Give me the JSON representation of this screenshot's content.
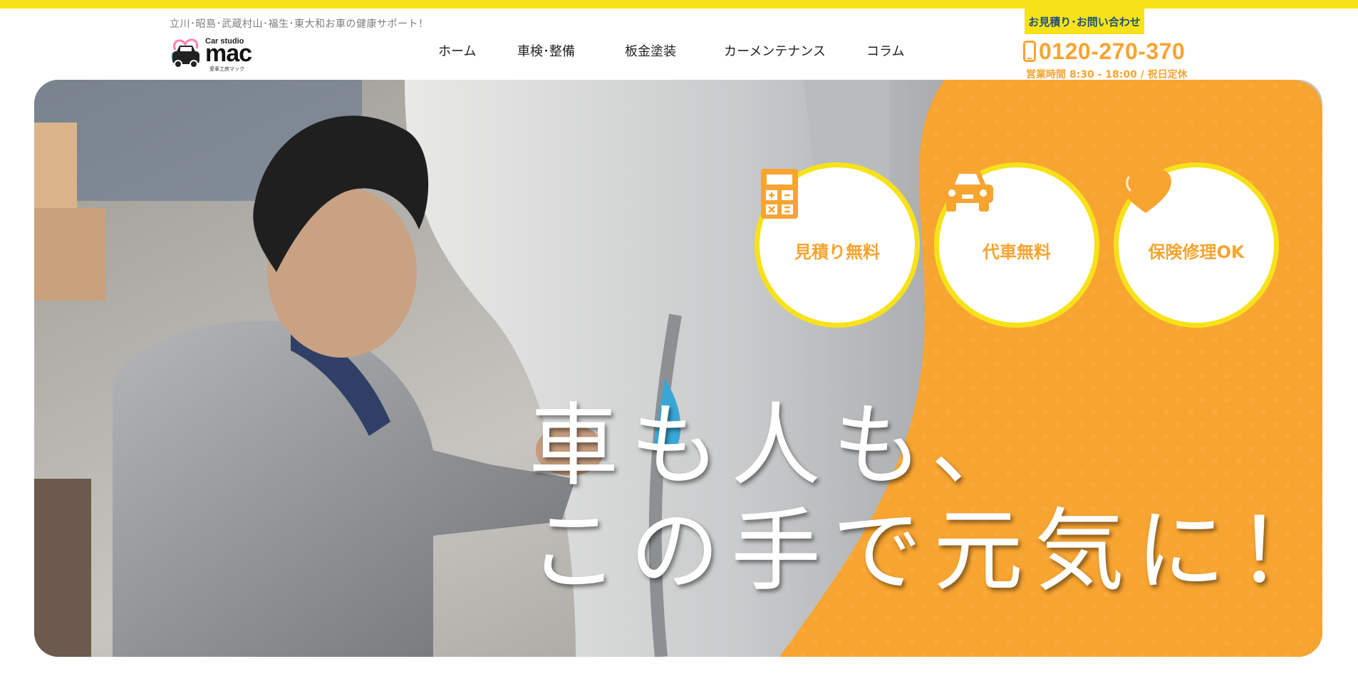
{
  "header": {
    "tagline": "立川･昭島･武蔵村山･福生･東大和お車の健康サポート！",
    "logo": {
      "small": "Car studio",
      "big": "mac",
      "jp": "愛車工房マック"
    },
    "nav": [
      "ホーム",
      "車検･整備",
      "板金塗装",
      "カーメンテナンス",
      "コラム"
    ],
    "cta_label": "お見積り･お問い合わせ",
    "phone": "0120-270-370",
    "hours": "営業時間 8:30 - 18:00 / 祝日定休"
  },
  "hero": {
    "badges": [
      {
        "label": "見積り無料",
        "icon": "calculator-icon"
      },
      {
        "label": "代車無料",
        "icon": "car-icon"
      },
      {
        "label": "保険修理OK",
        "icon": "heart-icon"
      }
    ],
    "headline_line1": "車も人も、",
    "headline_line2": "この手で元気に！"
  },
  "colors": {
    "accent_yellow": "#f7e21a",
    "accent_orange": "#f7a431",
    "cta_text": "#1f4f7a"
  }
}
